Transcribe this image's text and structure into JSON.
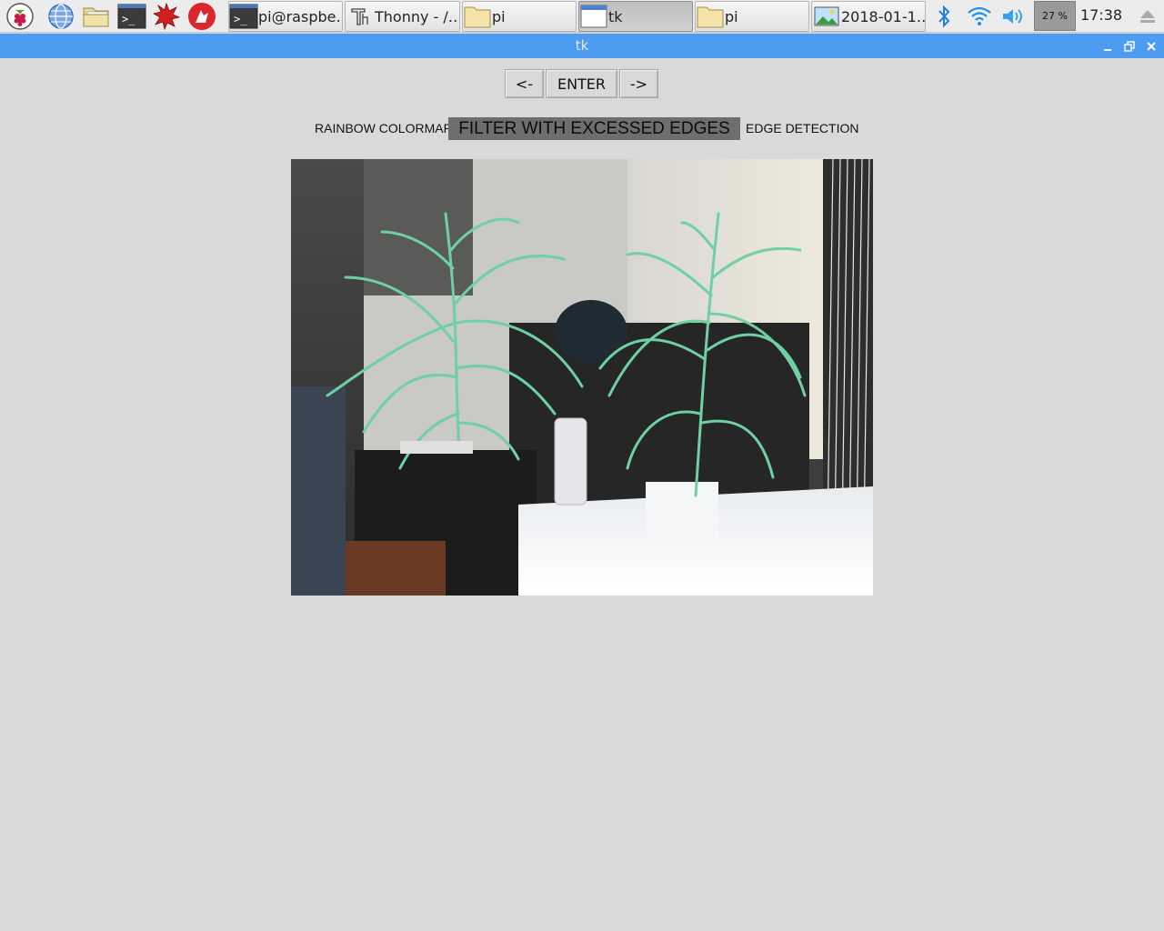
{
  "taskbar": {
    "launchers": [
      {
        "name": "raspberry-menu-icon"
      },
      {
        "name": "web-browser-icon"
      },
      {
        "name": "file-manager-icon"
      },
      {
        "name": "terminal-icon"
      },
      {
        "name": "mathematica-icon"
      },
      {
        "name": "wolfram-icon"
      }
    ],
    "tasks": [
      {
        "label": "pi@raspbe…",
        "icon": "terminal-icon",
        "active": false
      },
      {
        "label": "Thonny  -  /…",
        "icon": "thonny-icon",
        "active": false
      },
      {
        "label": "pi",
        "icon": "folder-icon",
        "active": false
      },
      {
        "label": "tk",
        "icon": "window-icon",
        "active": true
      },
      {
        "label": "pi",
        "icon": "folder-icon",
        "active": false
      },
      {
        "label": "2018-01-1…",
        "icon": "image-viewer-icon",
        "active": false
      }
    ],
    "cpu_label": "27 %",
    "cpu_percent": 27,
    "clock": "17:38"
  },
  "window": {
    "title": "tk"
  },
  "controls": {
    "prev_label": "<-",
    "enter_label": "ENTER",
    "next_label": "->"
  },
  "filters": {
    "left": "RAINBOW COLORMAP",
    "selected": "FILTER WITH EXCESSED EDGES",
    "right": "EDGE DETECTION"
  },
  "colors": {
    "titlebar": "#4e9bf2",
    "window_bg": "#d9d9d9",
    "selected_filter_bg": "#6e6e6e"
  }
}
